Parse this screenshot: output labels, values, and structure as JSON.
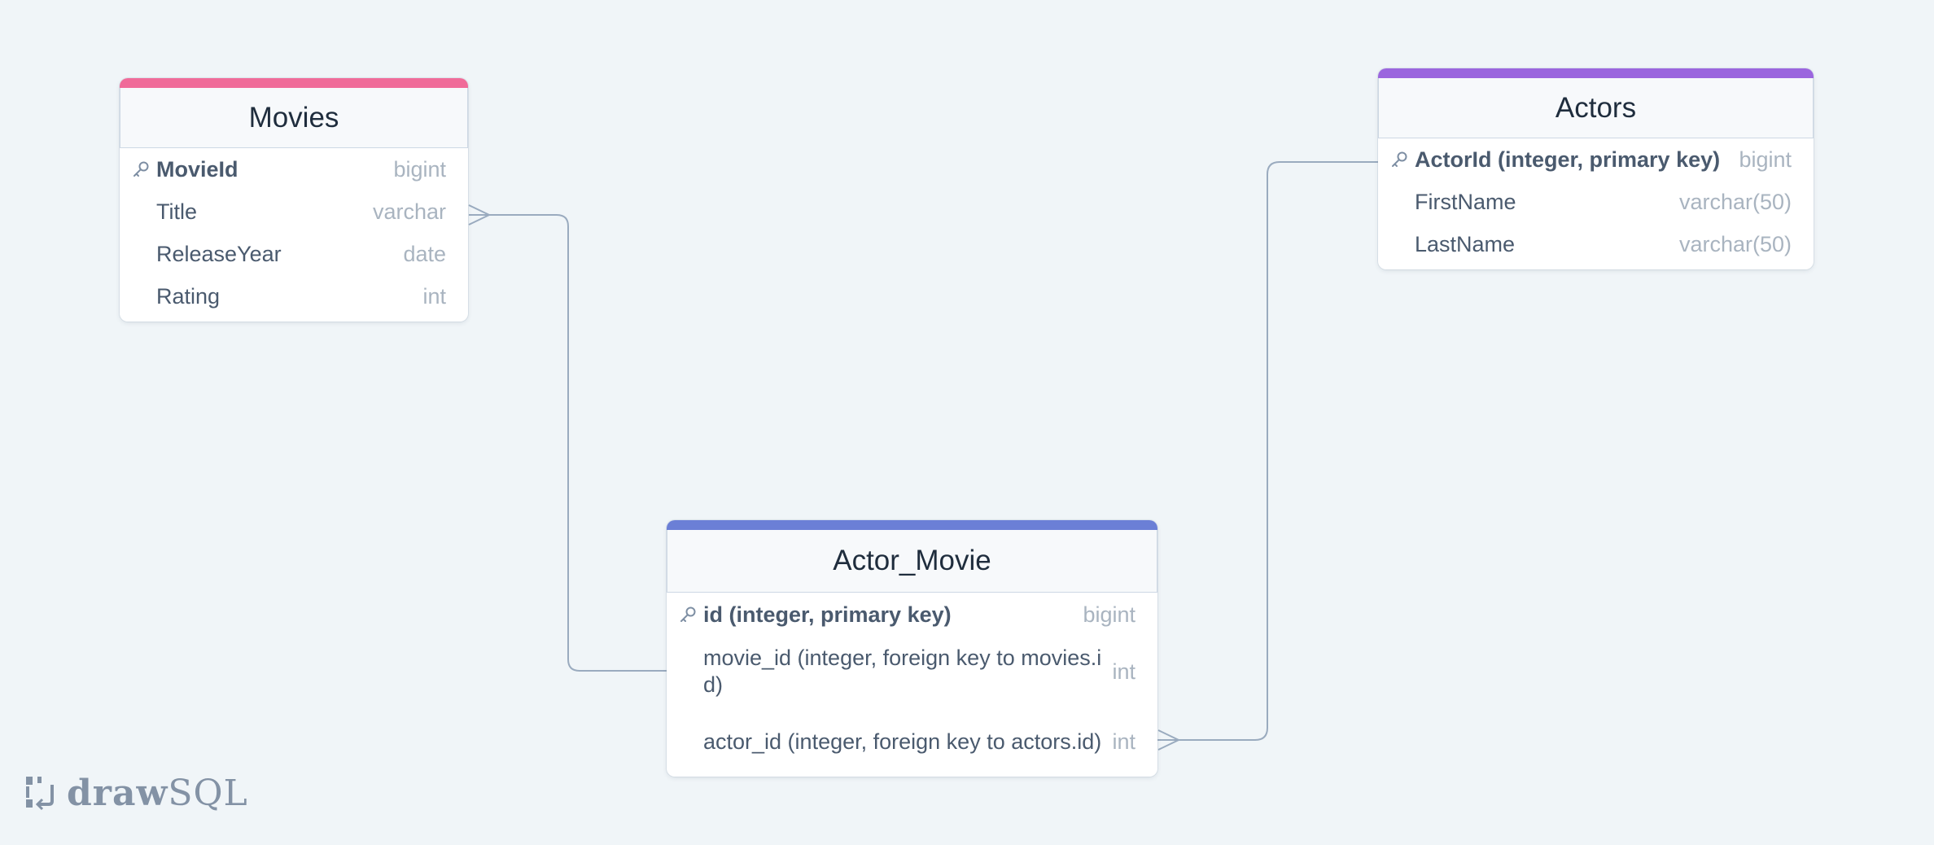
{
  "colors": {
    "background": "#f0f5f8",
    "movies_accent": "#f06b99",
    "actors_accent": "#9b66de",
    "actor_movie_accent": "#6b7fd6",
    "connector": "#9aabbf"
  },
  "tables": {
    "movies": {
      "title": "Movies",
      "fields": [
        {
          "name": "MovieId",
          "type": "bigint",
          "primary_key": true
        },
        {
          "name": "Title",
          "type": "varchar"
        },
        {
          "name": "ReleaseYear",
          "type": "date"
        },
        {
          "name": "Rating",
          "type": "int"
        }
      ]
    },
    "actors": {
      "title": "Actors",
      "fields": [
        {
          "name": "ActorId (integer, primary key)",
          "type": "bigint",
          "primary_key": true
        },
        {
          "name": "FirstName",
          "type": "varchar(50)"
        },
        {
          "name": "LastName",
          "type": "varchar(50)"
        }
      ]
    },
    "actor_movie": {
      "title": "Actor_Movie",
      "fields": [
        {
          "name": "id (integer, primary key)",
          "type": "bigint",
          "primary_key": true
        },
        {
          "name": "movie_id (integer, foreign key to movies.id)",
          "type": "int"
        },
        {
          "name": "actor_id (integer, foreign key to actors.id)",
          "type": "int"
        }
      ]
    }
  },
  "relationships": [
    {
      "from": "actor_movie.movie_id",
      "to": "movies.Title",
      "many_end": "movies"
    },
    {
      "from": "actors.ActorId",
      "to": "actor_movie.actor_id",
      "many_end": "actor_movie"
    }
  ],
  "logo": {
    "text_bold": "draw",
    "text_light": "SQL",
    "icon": "drawsql-logo-icon"
  }
}
